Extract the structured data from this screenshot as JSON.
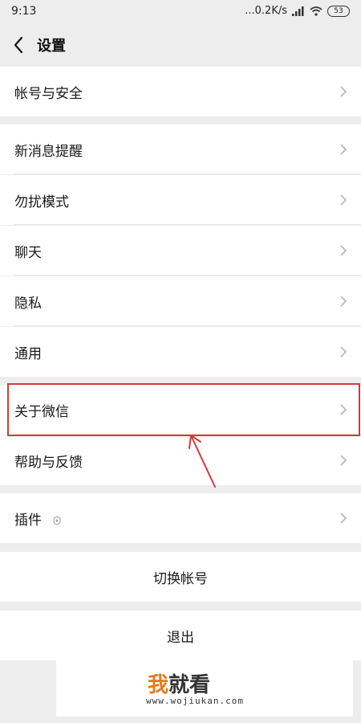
{
  "status_bar": {
    "time": "9:13",
    "network_speed": "...0.2K/s",
    "battery": "53"
  },
  "nav": {
    "title": "设置",
    "back_icon": "chevron-left-icon"
  },
  "menu": {
    "account_security": "帐号与安全",
    "new_message_alert": "新消息提醒",
    "do_not_disturb": "勿扰模式",
    "chat": "聊天",
    "privacy": "隐私",
    "general": "通用",
    "about_wechat": "关于微信",
    "help_feedback": "帮助与反馈",
    "plugins": "插件"
  },
  "actions": {
    "switch_account": "切换帐号",
    "logout": "退出"
  },
  "annotation": {
    "highlight_color": "#d33a3a"
  },
  "watermark": {
    "logo_text_first": "我",
    "logo_text_rest": "就看",
    "url": "www.wojiukan.com",
    "accent_color": "#e37a1f"
  }
}
